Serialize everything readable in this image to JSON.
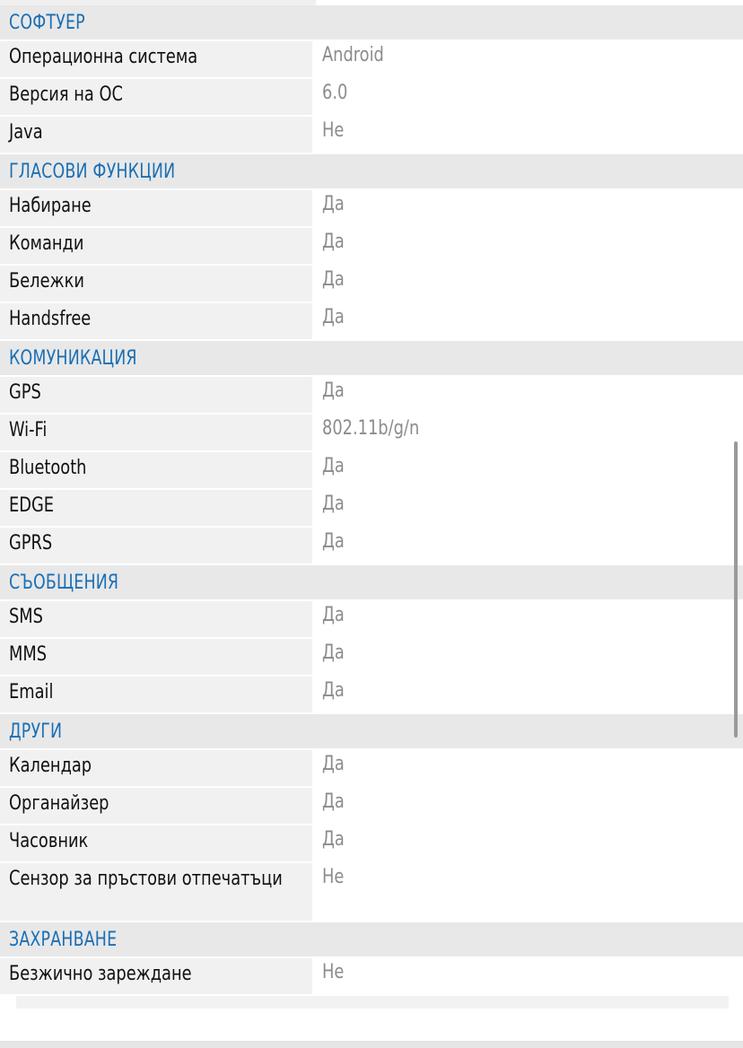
{
  "sections": [
    {
      "title": "СОФТУЕР",
      "rows": [
        {
          "label": "Операционна система",
          "value": "Android"
        },
        {
          "label": "Версия на ОС",
          "value": "6.0"
        },
        {
          "label": "Java",
          "value": "Не"
        }
      ]
    },
    {
      "title": "ГЛАСОВИ ФУНКЦИИ",
      "rows": [
        {
          "label": "Набиране",
          "value": "Да"
        },
        {
          "label": "Команди",
          "value": "Да"
        },
        {
          "label": "Бележки",
          "value": "Да"
        },
        {
          "label": "Handsfree",
          "value": "Да"
        }
      ]
    },
    {
      "title": "КОМУНИКАЦИЯ",
      "rows": [
        {
          "label": "GPS",
          "value": "Да"
        },
        {
          "label": "Wi-Fi",
          "value": "802.11b/g/n"
        },
        {
          "label": "Bluetooth",
          "value": "Да"
        },
        {
          "label": "EDGE",
          "value": "Да"
        },
        {
          "label": "GPRS",
          "value": "Да"
        }
      ]
    },
    {
      "title": "СЪОБЩЕНИЯ",
      "rows": [
        {
          "label": "SMS",
          "value": "Да"
        },
        {
          "label": "MMS",
          "value": "Да"
        },
        {
          "label": "Email",
          "value": "Да"
        }
      ]
    },
    {
      "title": "ДРУГИ",
      "rows": [
        {
          "label": "Календар",
          "value": "Да"
        },
        {
          "label": "Органайзер",
          "value": "Да"
        },
        {
          "label": "Часовник",
          "value": "Да"
        },
        {
          "label": "Сензор за пръстови отпечатъци",
          "value": "Не"
        }
      ]
    },
    {
      "title": "ЗАХРАНВАНЕ",
      "rows": [
        {
          "label": "Безжично зареждане",
          "value": "Не"
        }
      ]
    }
  ]
}
